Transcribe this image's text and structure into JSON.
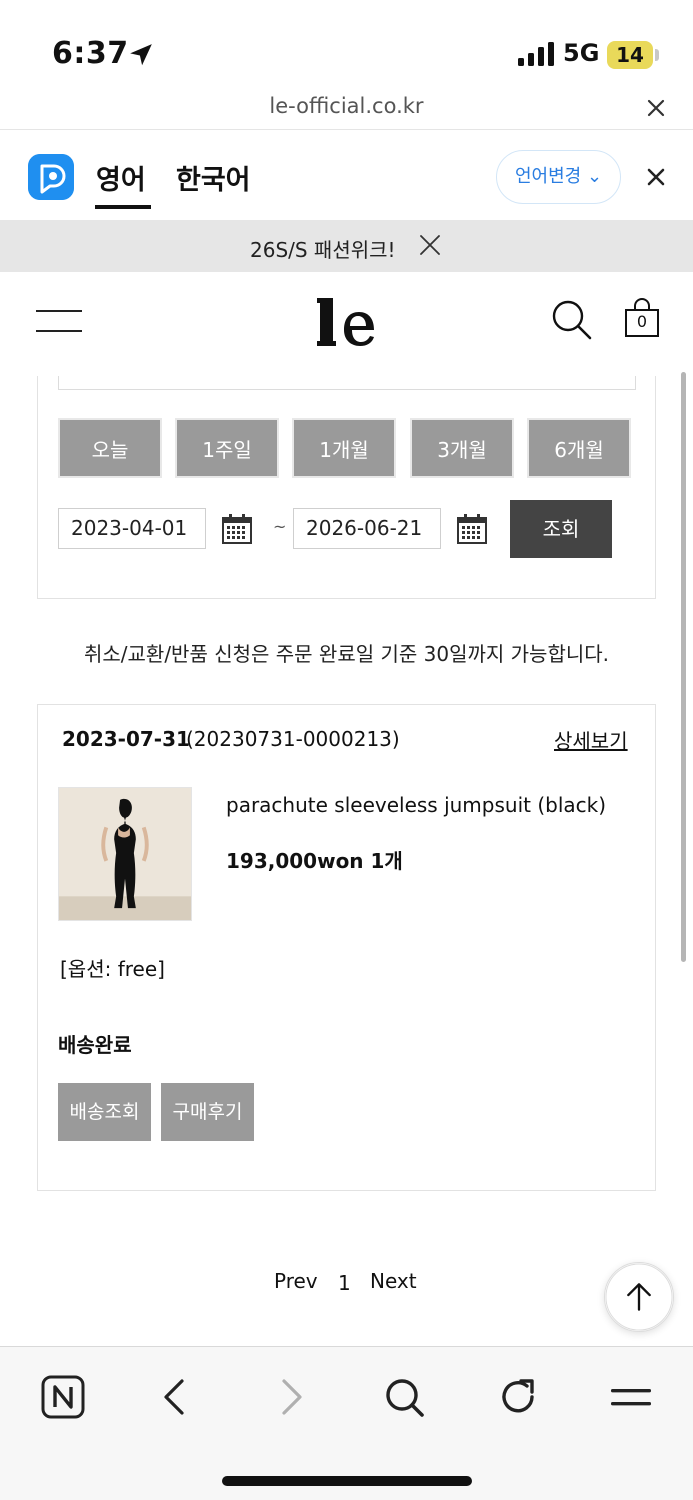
{
  "status_bar": {
    "time": "6:37",
    "network": "5G",
    "battery": "14",
    "icons": [
      "location-arrow-icon",
      "signal-icon"
    ]
  },
  "browser": {
    "url": "le-official.co.kr"
  },
  "translate_bar": {
    "tab_source": "영어",
    "tab_target": "한국어",
    "change_language": "언어변경",
    "change_language_chevron": "⌄",
    "icons": [
      "papago-logo-icon",
      "close-icon"
    ]
  },
  "announcement": {
    "text": "26S/S 패션위크!"
  },
  "header": {
    "logo": "le",
    "cart_count": "0",
    "icons": [
      "hamburger-menu-icon",
      "search-icon",
      "shopping-bag-icon"
    ]
  },
  "filter": {
    "period_buttons": [
      "오늘",
      "1주일",
      "1개월",
      "3개월",
      "6개월"
    ],
    "date_from": "2023-04-01",
    "date_separator": "~",
    "date_to": "2026-06-21",
    "search_label": "조회"
  },
  "notice": "취소/교환/반품 신청은 주문 완료일 기준 30일까지 가능합니다.",
  "order": {
    "date": "2023-07-31",
    "order_number": "(20230731-0000213)",
    "detail_link": "상세보기",
    "product_name": "parachute sleeveless jumpsuit (black)",
    "price": "193,000won 1개",
    "option": "[옵션: free]",
    "shipping_status": "배송완료",
    "buttons": [
      "배송조회",
      "구매후기"
    ]
  },
  "pagination": {
    "prev": "Prev",
    "current": "1",
    "next": "Next"
  },
  "toolbar": {
    "icons": [
      "naver-home-icon",
      "back-icon",
      "forward-icon",
      "search-icon",
      "refresh-icon",
      "menu-icon",
      "scroll-to-top-icon"
    ]
  }
}
